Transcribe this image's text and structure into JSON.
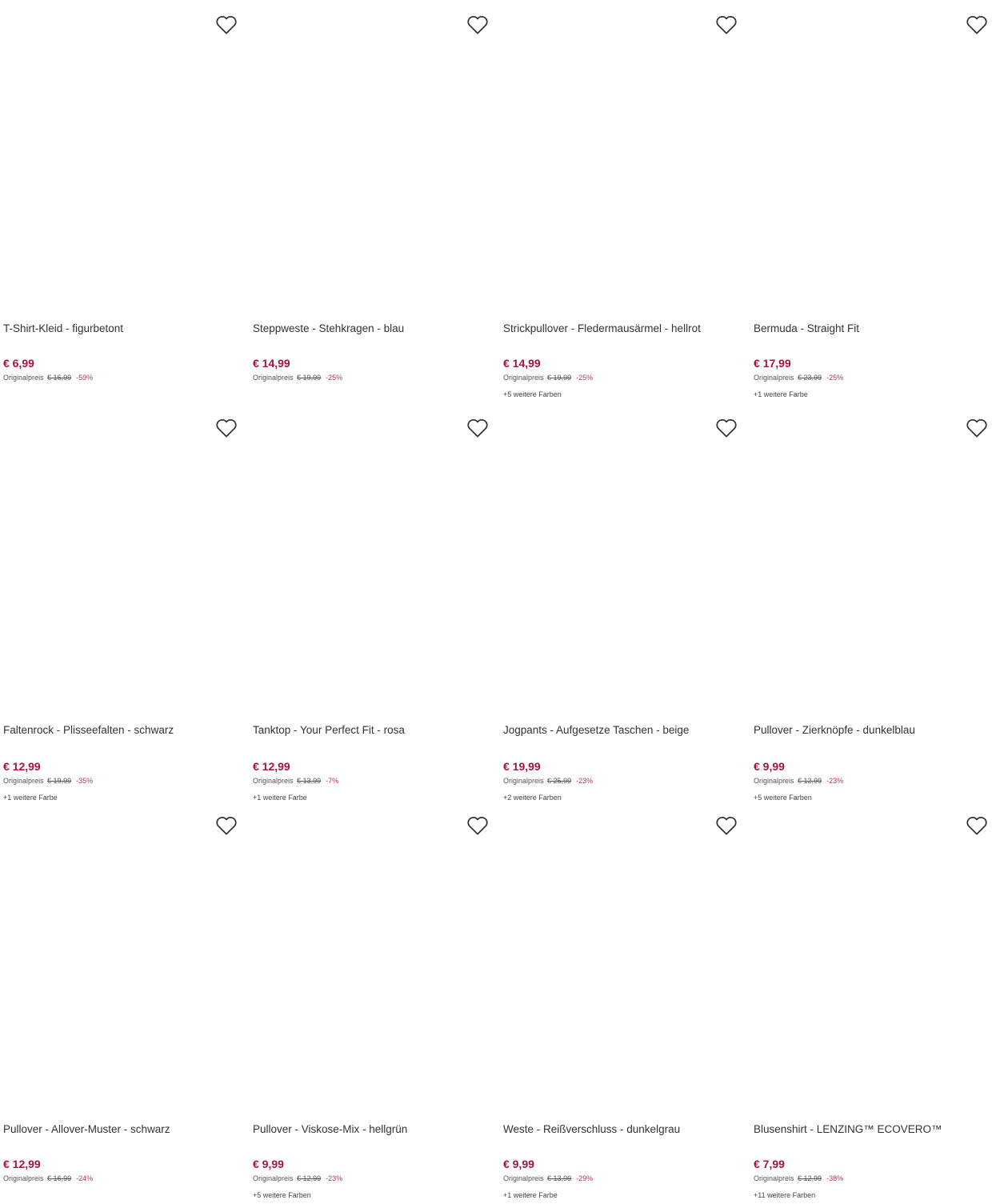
{
  "theme": {
    "price_color": "#a6133d",
    "discount_color": "#b4385a",
    "heart_color": "#333333"
  },
  "labels": {
    "original_price": "Originalpreis"
  },
  "products": [
    {
      "title": "T-Shirt-Kleid - figurbetont",
      "price": "€ 6,99",
      "original": "€ 16,99",
      "discount": "-59%",
      "colors": ""
    },
    {
      "title": "Steppweste - Stehkragen - blau",
      "price": "€ 14,99",
      "original": "€ 19,99",
      "discount": "-25%",
      "colors": ""
    },
    {
      "title": "Strickpullover - Fledermausärmel - hellrot",
      "price": "€ 14,99",
      "original": "€ 19,99",
      "discount": "-25%",
      "colors": "+5 weitere Farben"
    },
    {
      "title": "Bermuda - Straight Fit",
      "price": "€ 17,99",
      "original": "€ 23,99",
      "discount": "-25%",
      "colors": "+1 weitere Farbe"
    },
    {
      "title": "Faltenrock - Plisseefalten - schwarz",
      "price": "€ 12,99",
      "original": "€ 19,99",
      "discount": "-35%",
      "colors": "+1 weitere Farbe"
    },
    {
      "title": "Tanktop - Your Perfect Fit - rosa",
      "price": "€ 12,99",
      "original": "€ 13,99",
      "discount": "-7%",
      "colors": "+1 weitere Farbe"
    },
    {
      "title": "Jogpants - Aufgesetze Taschen - beige",
      "price": "€ 19,99",
      "original": "€ 25,99",
      "discount": "-23%",
      "colors": "+2 weitere Farben"
    },
    {
      "title": "Pullover - Zierknöpfe - dunkelblau",
      "price": "€ 9,99",
      "original": "€ 12,99",
      "discount": "-23%",
      "colors": "+5 weitere Farben"
    },
    {
      "title": "Pullover - Allover-Muster - schwarz",
      "price": "€ 12,99",
      "original": "€ 16,99",
      "discount": "-24%",
      "colors": ""
    },
    {
      "title": "Pullover - Viskose-Mix - hellgrün",
      "price": "€ 9,99",
      "original": "€ 12,99",
      "discount": "-23%",
      "colors": "+5 weitere Farben"
    },
    {
      "title": "Weste - Reißverschluss - dunkelgrau",
      "price": "€ 9,99",
      "original": "€ 13,99",
      "discount": "-29%",
      "colors": "+1 weitere Farbe"
    },
    {
      "title": "Blusenshirt - LENZING™ ECOVERO™",
      "price": "€ 7,99",
      "original": "€ 12,99",
      "discount": "-38%",
      "colors": "+11 weitere Farben"
    }
  ]
}
